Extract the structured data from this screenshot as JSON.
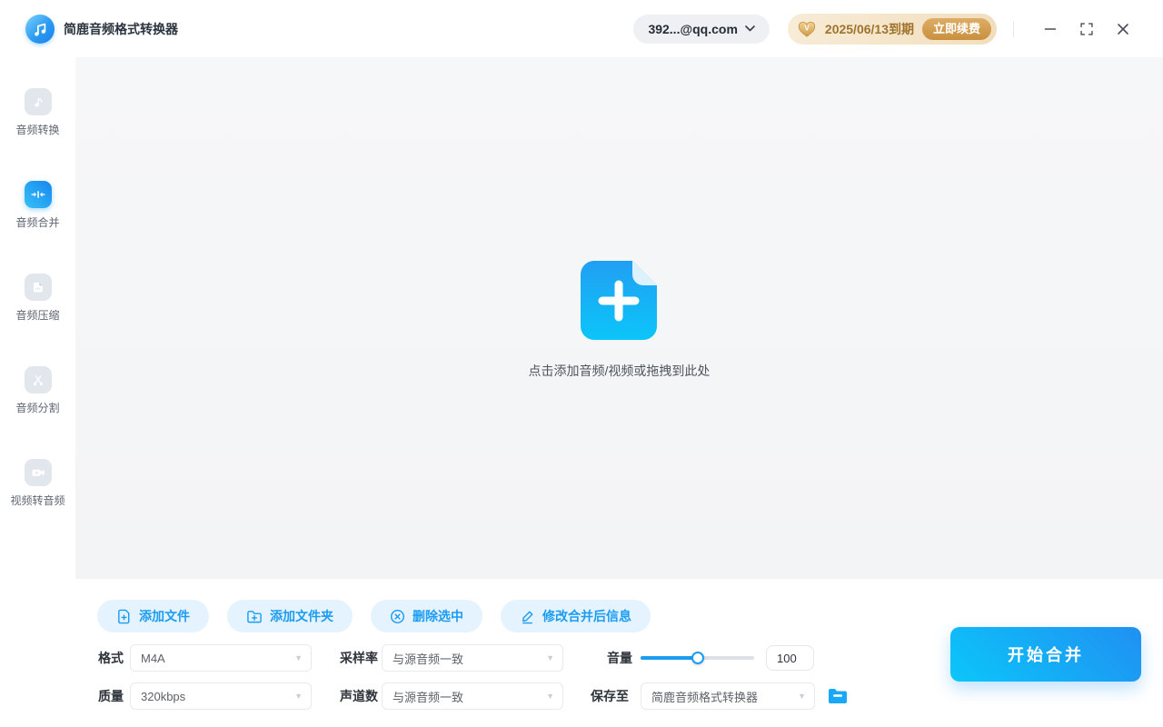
{
  "colors": {
    "accent_blue": "#1b9cf1",
    "accent_gradient_from": "#0bc6f9",
    "accent_gradient_to": "#2090f2",
    "toolbar_button_bg": "#e4f3fd",
    "dropzone_bg": "#f4f5f7",
    "inactive_icon_bg": "#e2e6ed",
    "vip_pill_bg": "#f3e2c4",
    "vip_text": "#a0732c",
    "renew_button_bg": "#c98f3e"
  },
  "header": {
    "app_title": "简鹿音频格式转换器",
    "account_email": "392...@qq.com",
    "expiry_date": "2025/06/13到期",
    "renew_label": "立即续费"
  },
  "sidebar": {
    "items": [
      {
        "label": "音频转换",
        "icon": "music-note-icon",
        "active": false
      },
      {
        "label": "音频合并",
        "icon": "merge-icon",
        "active": true
      },
      {
        "label": "音频压缩",
        "icon": "compress-icon",
        "active": false
      },
      {
        "label": "音频分割",
        "icon": "split-icon",
        "active": false
      },
      {
        "label": "视频转音频",
        "icon": "video-icon",
        "active": false
      }
    ]
  },
  "dropzone": {
    "hint": "点击添加音频/视频或拖拽到此处",
    "icon": "file-plus-icon"
  },
  "toolbar": {
    "add_file": "添加文件",
    "add_folder": "添加文件夹",
    "delete_selected": "删除选中",
    "modify_info": "修改合并后信息"
  },
  "settings": {
    "format_label": "格式",
    "format_value": "M4A",
    "sample_rate_label": "采样率",
    "sample_rate_value": "与源音频一致",
    "volume_label": "音量",
    "volume_value": "100",
    "volume_percent": 50,
    "quality_label": "质量",
    "quality_value": "320kbps",
    "channels_label": "声道数",
    "channels_value": "与源音频一致",
    "save_to_label": "保存至",
    "save_to_value": "简鹿音频格式转换器"
  },
  "actions": {
    "start_merge": "开始合并"
  }
}
